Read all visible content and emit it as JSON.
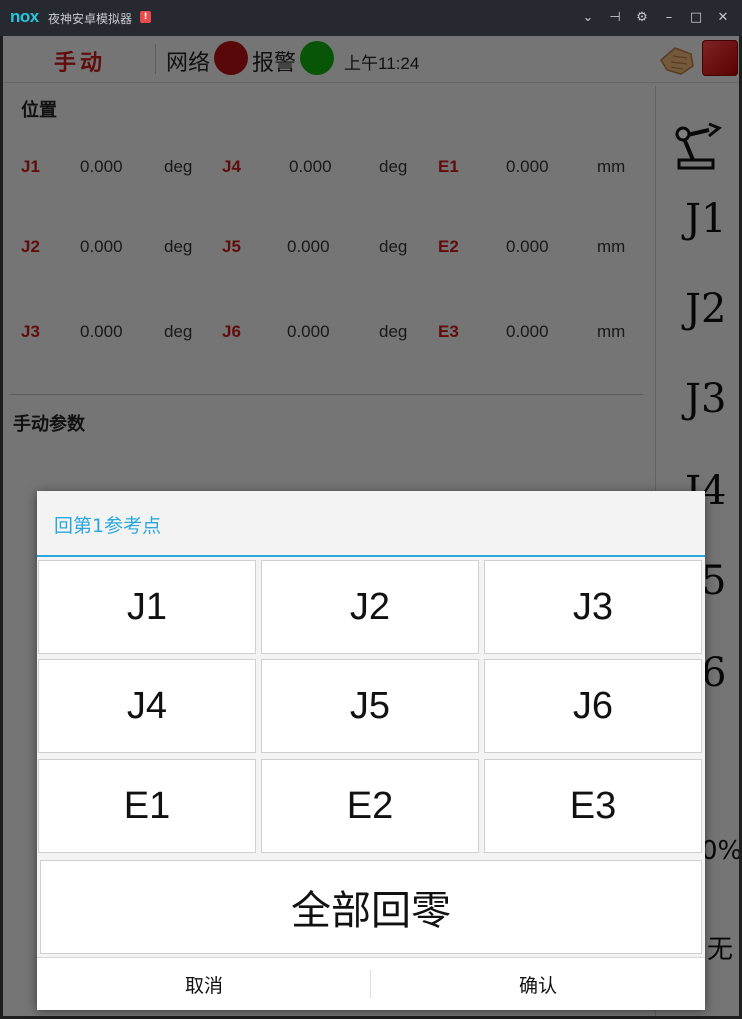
{
  "window": {
    "logo": "nox",
    "title": "夜神安卓模拟器",
    "warning_badge": "!",
    "controls": [
      {
        "name": "chevron-down-icon",
        "glyph": "⌄"
      },
      {
        "name": "pin-icon",
        "glyph": "⊣"
      },
      {
        "name": "gear-icon",
        "glyph": "⚙"
      },
      {
        "name": "minimize-icon",
        "glyph": "–"
      },
      {
        "name": "maximize-icon",
        "glyph": "□"
      },
      {
        "name": "close-icon",
        "glyph": "✕"
      }
    ]
  },
  "topbar": {
    "mode": "手动",
    "network_label": "网络",
    "alarm_label": "报警",
    "time": "上午11:24",
    "network_status_color": "#b01010",
    "alarm_status_color": "#11aa11"
  },
  "position": {
    "title": "位置",
    "rows": [
      [
        {
          "axis": "J1",
          "value": "0.000",
          "unit": "deg"
        },
        {
          "axis": "J4",
          "value": "0.000",
          "unit": "deg"
        },
        {
          "axis": "E1",
          "value": "0.000",
          "unit": "mm"
        }
      ],
      [
        {
          "axis": "J2",
          "value": "0.000",
          "unit": "deg"
        },
        {
          "axis": "J5",
          "value": "0.000",
          "unit": "deg"
        },
        {
          "axis": "E2",
          "value": "0.000",
          "unit": "mm"
        }
      ],
      [
        {
          "axis": "J3",
          "value": "0.000",
          "unit": "deg"
        },
        {
          "axis": "J6",
          "value": "0.000",
          "unit": "deg"
        },
        {
          "axis": "E3",
          "value": "0.000",
          "unit": "mm"
        }
      ]
    ]
  },
  "manual_params": {
    "title": "手动参数"
  },
  "side_panel": {
    "joints": [
      "J1",
      "J2",
      "J3",
      "J4",
      "J5",
      "J6"
    ],
    "percent_suffix": "0%",
    "none_label": "无"
  },
  "dialog": {
    "title": "回第1参考点",
    "axes": [
      "J1",
      "J2",
      "J3",
      "J4",
      "J5",
      "J6",
      "E1",
      "E2",
      "E3"
    ],
    "all_zero": "全部回零",
    "cancel": "取消",
    "confirm": "确认"
  }
}
